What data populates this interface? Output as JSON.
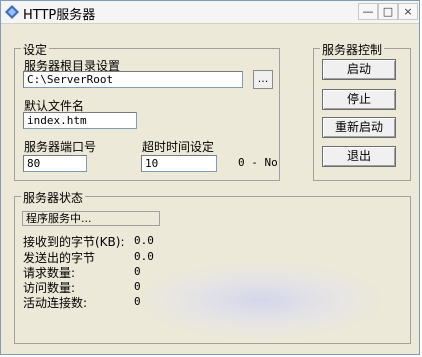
{
  "window": {
    "title": "HTTP服务器",
    "controls": {
      "minimize": "—",
      "maximize": "□",
      "close": "×"
    }
  },
  "settings": {
    "group_label": "设定",
    "root_dir_label": "服务器根目录设置",
    "root_dir_value": "C:\\ServerRoot",
    "browse_label": "...",
    "default_file_label": "默认文件名",
    "default_file_value": "index.htm",
    "port_label": "服务器端口号",
    "port_value": "80",
    "timeout_label": "超时时间设定",
    "timeout_value": "10",
    "timeout_hint": "0 - No"
  },
  "control": {
    "group_label": "服务器控制",
    "start": "启动",
    "stop": "停止",
    "restart": "重新启动",
    "exit": "退出"
  },
  "status": {
    "group_label": "服务器状态",
    "message": "程序服务中...",
    "rows": [
      {
        "label": "接收到的字节(KB):",
        "value": "0.0"
      },
      {
        "label": "发送出的字节",
        "value": "0.0"
      },
      {
        "label": "请求数量:",
        "value": "0"
      },
      {
        "label": "访问数量:",
        "value": "0"
      },
      {
        "label": "活动连接数:",
        "value": "0"
      }
    ]
  },
  "colors": {
    "window_bg": "#ece9d8",
    "icon": "#3a6ec8"
  }
}
